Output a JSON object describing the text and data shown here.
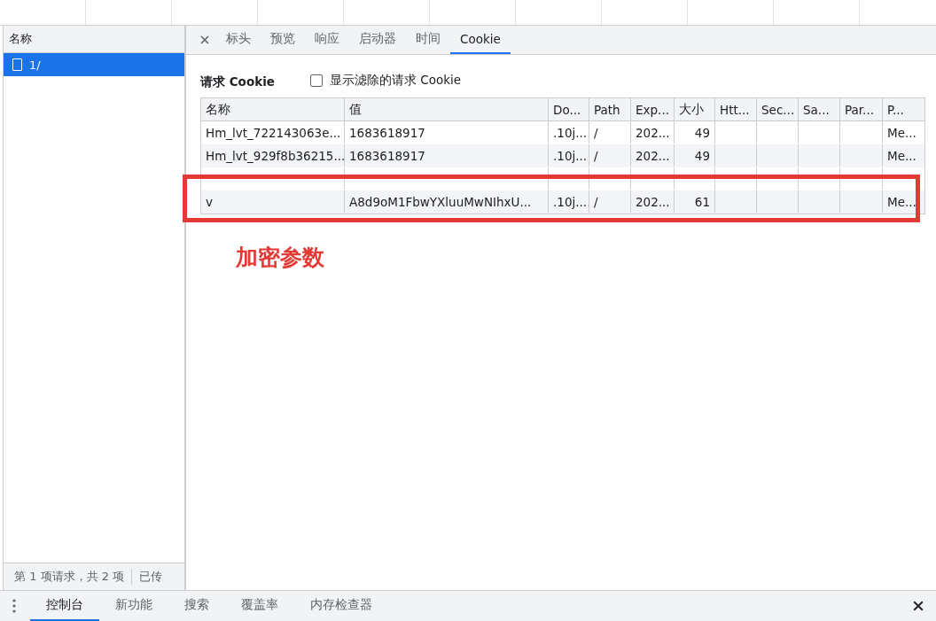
{
  "request_list": {
    "header": "名称",
    "items": [
      {
        "label": "1/",
        "selected": true
      }
    ],
    "status": "第 1 项请求，共 2 项",
    "status_cut": "已传"
  },
  "detail_tabs": [
    {
      "label": "标头",
      "selected": false
    },
    {
      "label": "预览",
      "selected": false
    },
    {
      "label": "响应",
      "selected": false
    },
    {
      "label": "启动器",
      "selected": false
    },
    {
      "label": "时间",
      "selected": false
    },
    {
      "label": "Cookie",
      "selected": true
    }
  ],
  "cookies": {
    "title": "请求 Cookie",
    "filter_checkbox": {
      "label": "显示滤除的请求 Cookie",
      "checked": false
    },
    "columns": [
      "名称",
      "值",
      "Do...",
      "Path",
      "Exp...",
      "大小",
      "Htt...",
      "Sec...",
      "Sa...",
      "Par...",
      "P..."
    ],
    "rows": [
      {
        "cells": [
          "Hm_lvt_722143063e...",
          "1683618917",
          ".10j...",
          "/",
          "202...",
          "49",
          "",
          "",
          "",
          "",
          "Me..."
        ]
      },
      {
        "cells": [
          "Hm_lvt_929f8b36215...",
          "1683618917",
          ".10j...",
          "/",
          "202...",
          "49",
          "",
          "",
          "",
          "",
          "Me..."
        ]
      },
      {
        "cells": [
          "",
          "",
          "",
          "",
          "",
          "",
          "",
          "",
          "",
          "",
          ""
        ]
      },
      {
        "cells": [
          "v",
          "A8d9oM1FbwYXluuMwNIhxU...",
          ".10j...",
          "/",
          "202...",
          "61",
          "",
          "",
          "",
          "",
          "Me..."
        ]
      }
    ]
  },
  "annotation": {
    "label": "加密参数"
  },
  "drawer_tabs": [
    {
      "label": "控制台",
      "selected": true
    },
    {
      "label": "新功能",
      "selected": false
    },
    {
      "label": "搜索",
      "selected": false
    },
    {
      "label": "覆盖率",
      "selected": false
    },
    {
      "label": "内存检查器",
      "selected": false
    }
  ]
}
